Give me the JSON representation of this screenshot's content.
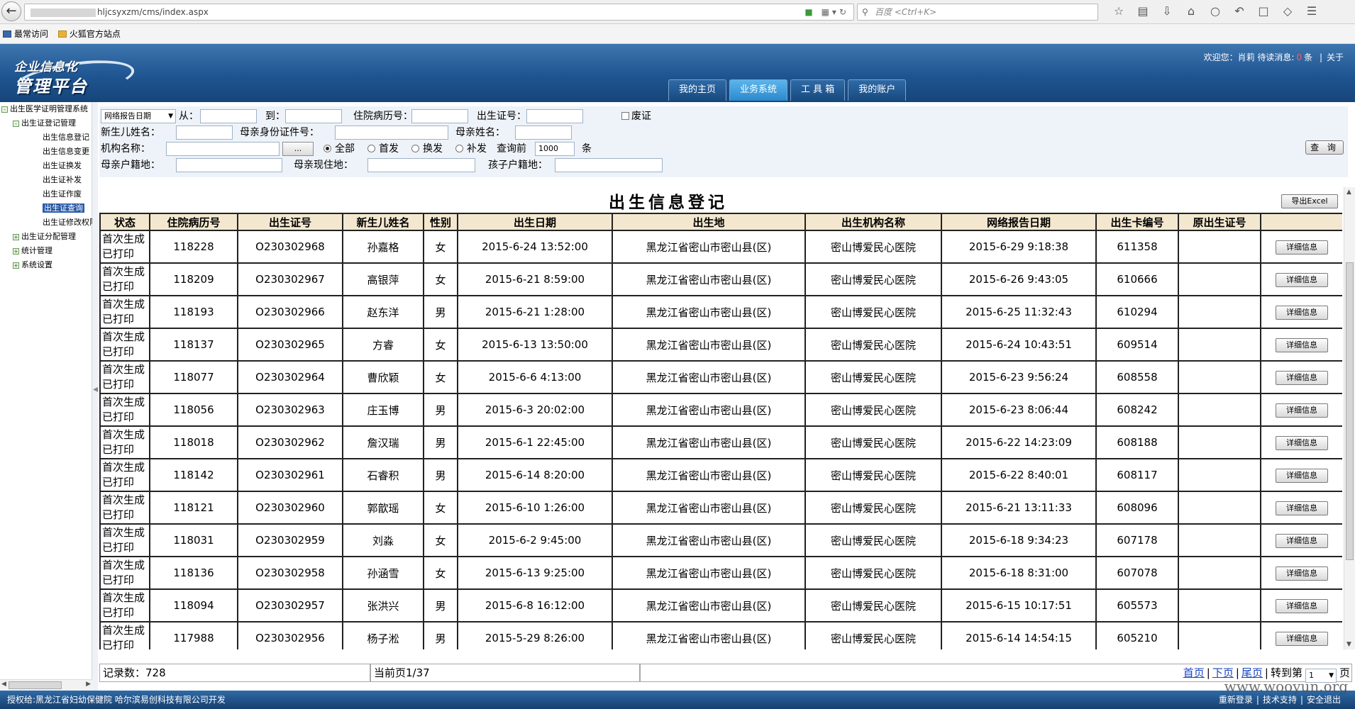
{
  "browser": {
    "url": "hljcsyxzm/cms/index.aspx",
    "search_placeholder": "百度 <Ctrl+K>"
  },
  "bookmarks": [
    "最常访问",
    "火狐官方站点"
  ],
  "header": {
    "logo_line1": "企业信息化",
    "logo_line2": "管理平台",
    "welcome_prefix": "欢迎您：肖莉",
    "unread_label": "待读消息:",
    "unread_count": "0",
    "unread_unit": "条",
    "about": "关于",
    "tabs": [
      "我的主页",
      "业务系统",
      "工 具 箱",
      "我的账户"
    ]
  },
  "sidebar": {
    "root": "出生医学证明管理系统",
    "group1": "出生证登记管理",
    "leaves": [
      "出生信息登记",
      "出生信息变更",
      "出生证换发",
      "出生证补发",
      "出生证作废",
      "出生证查询",
      "出生证修改权限"
    ],
    "group2": "出生证分配管理",
    "group3": "统计管理",
    "group4": "系统设置"
  },
  "filters": {
    "date_type": "网络报告日期",
    "from_label": "从：",
    "to_label": "到：",
    "record_no_label": "住院病历号：",
    "cert_no_label": "出生证号：",
    "void_label": "废证",
    "baby_name_label": "新生儿姓名：",
    "mother_id_label": "母亲身份证件号：",
    "mother_name_label": "母亲姓名：",
    "org_label": "机构名称：",
    "dots": "...",
    "radio_all": "全部",
    "radio_first": "首发",
    "radio_change": "换发",
    "radio_reissue": "补发",
    "query_before_label": "查询前",
    "query_count": "1000",
    "query_unit": "条",
    "mother_reg_label": "母亲户籍地：",
    "mother_addr_label": "母亲现住地：",
    "child_reg_label": "孩子户籍地：",
    "query_button": "查 询"
  },
  "page_title": "出生信息登记",
  "export_button": "导出Excel",
  "table": {
    "columns": [
      "状态",
      "住院病历号",
      "出生证号",
      "新生儿姓名",
      "性别",
      "出生日期",
      "出生地",
      "出生机构名称",
      "网络报告日期",
      "出生卡编号",
      "原出生证号",
      ""
    ],
    "status_line1": "首次生成",
    "status_line2": "已打印",
    "detail_label": "详细信息",
    "rows": [
      [
        "118228",
        "O230302968",
        "孙嘉格",
        "女",
        "2015-6-24 13:52:00",
        "黑龙江省密山市密山县(区)",
        "密山博爱民心医院",
        "2015-6-29 9:18:38",
        "611358",
        ""
      ],
      [
        "118209",
        "O230302967",
        "高银萍",
        "女",
        "2015-6-21 8:59:00",
        "黑龙江省密山市密山县(区)",
        "密山博爱民心医院",
        "2015-6-26 9:43:05",
        "610666",
        ""
      ],
      [
        "118193",
        "O230302966",
        "赵东洋",
        "男",
        "2015-6-21 1:28:00",
        "黑龙江省密山市密山县(区)",
        "密山博爱民心医院",
        "2015-6-25 11:32:43",
        "610294",
        ""
      ],
      [
        "118137",
        "O230302965",
        "方睿",
        "女",
        "2015-6-13 13:50:00",
        "黑龙江省密山市密山县(区)",
        "密山博爱民心医院",
        "2015-6-24 10:43:51",
        "609514",
        ""
      ],
      [
        "118077",
        "O230302964",
        "曹欣颖",
        "女",
        "2015-6-6 4:13:00",
        "黑龙江省密山市密山县(区)",
        "密山博爱民心医院",
        "2015-6-23 9:56:24",
        "608558",
        ""
      ],
      [
        "118056",
        "O230302963",
        "庄玉博",
        "男",
        "2015-6-3 20:02:00",
        "黑龙江省密山市密山县(区)",
        "密山博爱民心医院",
        "2015-6-23 8:06:44",
        "608242",
        ""
      ],
      [
        "118018",
        "O230302962",
        "詹汉瑞",
        "男",
        "2015-6-1 22:45:00",
        "黑龙江省密山市密山县(区)",
        "密山博爱民心医院",
        "2015-6-22 14:23:09",
        "608188",
        ""
      ],
      [
        "118142",
        "O230302961",
        "石睿积",
        "男",
        "2015-6-14 8:20:00",
        "黑龙江省密山市密山县(区)",
        "密山博爱民心医院",
        "2015-6-22 8:40:01",
        "608117",
        ""
      ],
      [
        "118121",
        "O230302960",
        "郭歆瑶",
        "女",
        "2015-6-10 1:26:00",
        "黑龙江省密山市密山县(区)",
        "密山博爱民心医院",
        "2015-6-21 13:11:33",
        "608096",
        ""
      ],
      [
        "118031",
        "O230302959",
        "刘淼",
        "女",
        "2015-6-2 9:45:00",
        "黑龙江省密山市密山县(区)",
        "密山博爱民心医院",
        "2015-6-18 9:34:23",
        "607178",
        ""
      ],
      [
        "118136",
        "O230302958",
        "孙涵雪",
        "女",
        "2015-6-13 9:25:00",
        "黑龙江省密山市密山县(区)",
        "密山博爱民心医院",
        "2015-6-18 8:31:00",
        "607078",
        ""
      ],
      [
        "118094",
        "O230302957",
        "张洪兴",
        "男",
        "2015-6-8 16:12:00",
        "黑龙江省密山市密山县(区)",
        "密山博爱民心医院",
        "2015-6-15 10:17:51",
        "605573",
        ""
      ],
      [
        "117988",
        "O230302956",
        "杨子淞",
        "男",
        "2015-5-29 8:26:00",
        "黑龙江省密山市密山县(区)",
        "密山博爱民心医院",
        "2015-6-14 14:54:15",
        "605210",
        ""
      ]
    ]
  },
  "pager": {
    "record_count": "记录数：728",
    "current_page": "当前页1/37",
    "first": "首页",
    "next": "下页",
    "last": "尾页",
    "goto_label": "转到第",
    "goto_value": "1",
    "goto_unit": "页"
  },
  "footer": {
    "left": "授权给:黑龙江省妇幼保健院   哈尔滨易创科技有限公司开发",
    "relogin": "重新登录",
    "support": "技术支持",
    "logout": "安全退出"
  },
  "watermark": "www.wooyun.org",
  "colors": {
    "header_blue": "#1f5590",
    "tab_active": "#2a89cf",
    "table_header_bg": "#f3e8cf",
    "link_blue": "#1a44c0",
    "unread_red": "#ff5a5a"
  }
}
